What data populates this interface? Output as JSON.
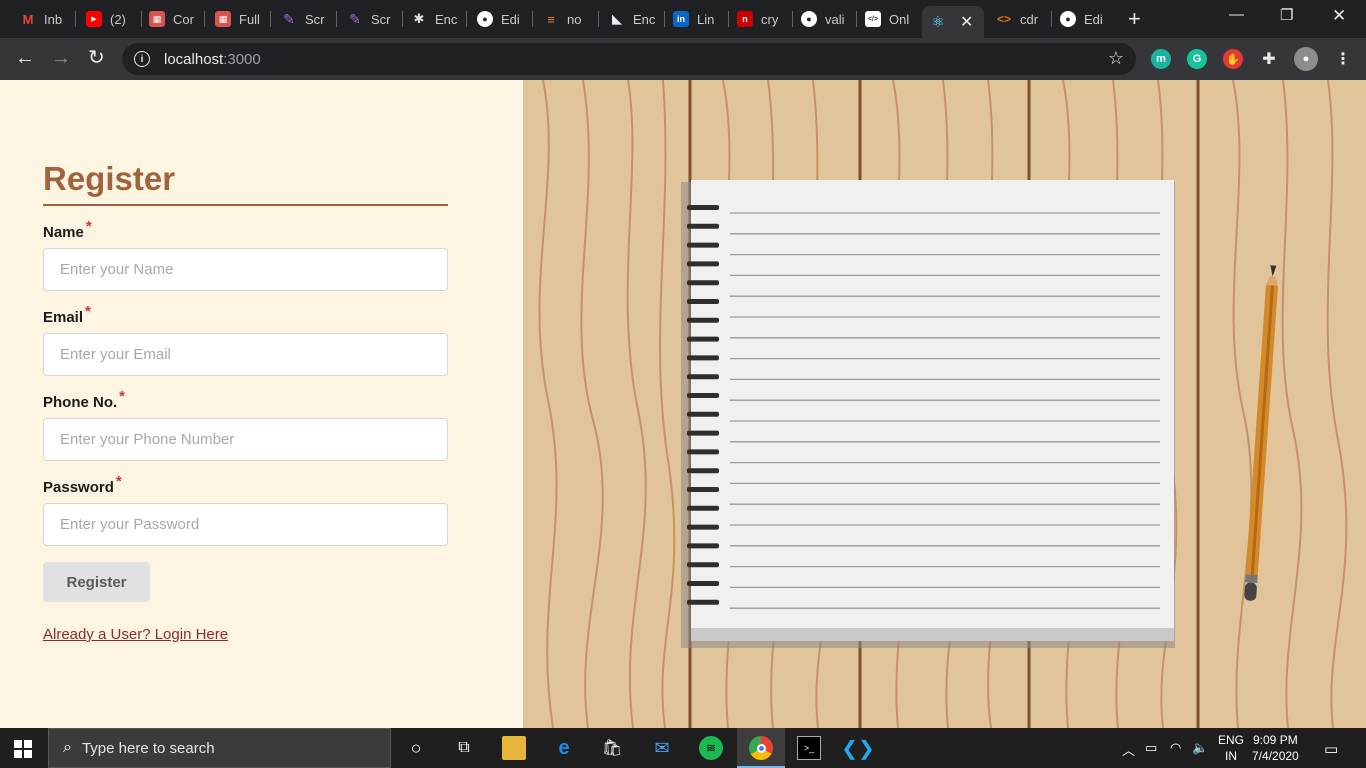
{
  "browser": {
    "tabs": [
      {
        "label": "Inb",
        "icon": "gmail-icon",
        "color": "#ea4335",
        "glyph": "M"
      },
      {
        "label": "(2)",
        "icon": "youtube-icon",
        "color": "#ff0000",
        "glyph": "▶"
      },
      {
        "label": "Cor",
        "icon": "grid-icon",
        "color": "#d9534f",
        "glyph": "▦"
      },
      {
        "label": "Full",
        "icon": "grid-icon",
        "color": "#d9534f",
        "glyph": "▦"
      },
      {
        "label": "Scr",
        "icon": "quill-icon",
        "color": "#7e57c2",
        "glyph": "✎"
      },
      {
        "label": "Scr",
        "icon": "quill-icon",
        "color": "#7e57c2",
        "glyph": "✎"
      },
      {
        "label": "Enc",
        "icon": "bee-icon",
        "color": "#333333",
        "glyph": "✱"
      },
      {
        "label": "Edi",
        "icon": "github-icon",
        "color": "#24292e",
        "glyph": "●"
      },
      {
        "label": "no",
        "icon": "stackoverflow-icon",
        "color": "#f48024",
        "glyph": "≡"
      },
      {
        "label": "Enc",
        "icon": "triangle-icon",
        "color": "#333333",
        "glyph": "◣"
      },
      {
        "label": "Lin",
        "icon": "linkedin-icon",
        "color": "#0a66c2",
        "glyph": "in"
      },
      {
        "label": "cry",
        "icon": "n-icon",
        "color": "#cc0000",
        "glyph": "n"
      },
      {
        "label": "vali",
        "icon": "github-icon",
        "color": "#24292e",
        "glyph": "●"
      },
      {
        "label": "Onl",
        "icon": "code-icon",
        "color": "#ffffff",
        "glyph": "</>"
      }
    ],
    "active_tab": {
      "icon": "react-icon",
      "color": "#61dafb",
      "glyph": "⚛"
    },
    "tabs_after": [
      {
        "label": "cdr",
        "icon": "brackets-icon",
        "color": "#e8710a",
        "glyph": "<>"
      },
      {
        "label": "Edi",
        "icon": "github-icon",
        "color": "#24292e",
        "glyph": "●"
      }
    ],
    "address": {
      "host": "localhost",
      "port": ":3000"
    },
    "extensions": [
      {
        "icon": "m-extension-icon",
        "color": "#1bb3a0",
        "glyph": "m"
      },
      {
        "icon": "grammarly-icon",
        "color": "#15c39a",
        "glyph": "G"
      },
      {
        "icon": "hand-extension-icon",
        "color": "#e53935",
        "glyph": "✋"
      }
    ]
  },
  "form": {
    "title": "Register",
    "fields": [
      {
        "label": "Name",
        "placeholder": "Enter your Name"
      },
      {
        "label": "Email",
        "placeholder": "Enter your Email"
      },
      {
        "label": "Phone No.",
        "placeholder": "Enter your Phone Number"
      },
      {
        "label": "Password",
        "placeholder": "Enter your Password"
      }
    ],
    "required_mark": "*",
    "submit_label": "Register",
    "login_link": "Already a User? Login Here"
  },
  "taskbar": {
    "search_placeholder": "Type here to search",
    "lang_top": "ENG",
    "lang_bottom": "IN",
    "time": "9:09 PM",
    "date": "7/4/2020"
  },
  "colors": {
    "accent": "#a0633e",
    "form_bg": "#fdf5e1",
    "wood": "#e2c49a",
    "required": "#d9302c"
  }
}
